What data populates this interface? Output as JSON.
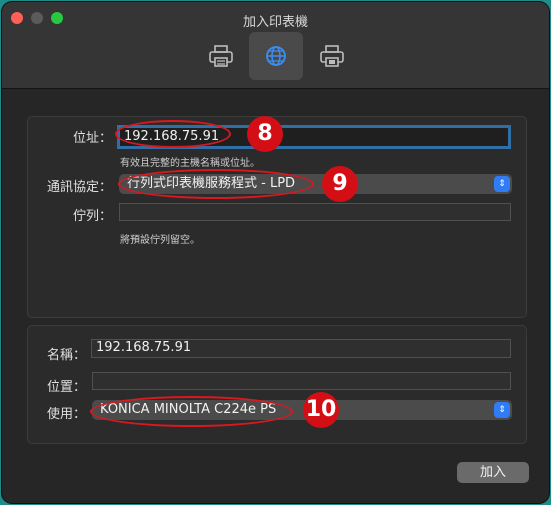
{
  "window": {
    "title": "加入印表機"
  },
  "toolbar": {
    "items": [
      {
        "icon": "printer-icon",
        "selected": false
      },
      {
        "icon": "globe-icon",
        "selected": true
      },
      {
        "icon": "printer-folder-icon",
        "selected": false
      }
    ]
  },
  "top_form": {
    "address_label": "位址：",
    "address_value": "192.168.75.91",
    "address_hint": "有效且完整的主機名稱或位址。",
    "protocol_label": "通訊協定：",
    "protocol_value": "行列式印表機服務程式 - LPD",
    "queue_label": "佇列：",
    "queue_value": "",
    "queue_hint": "將預設佇列留空。"
  },
  "bottom_form": {
    "name_label": "名稱：",
    "name_value": "192.168.75.91",
    "location_label": "位置：",
    "location_value": "",
    "use_label": "使用：",
    "use_value": "KONICA MINOLTA C224e PS"
  },
  "annotations": {
    "n8": "8",
    "n9": "9",
    "n10": "10"
  },
  "buttons": {
    "add": "加入"
  },
  "colors": {
    "accent": "#2f7cf6",
    "annotation_red": "#d30f15",
    "background": "#262626"
  }
}
